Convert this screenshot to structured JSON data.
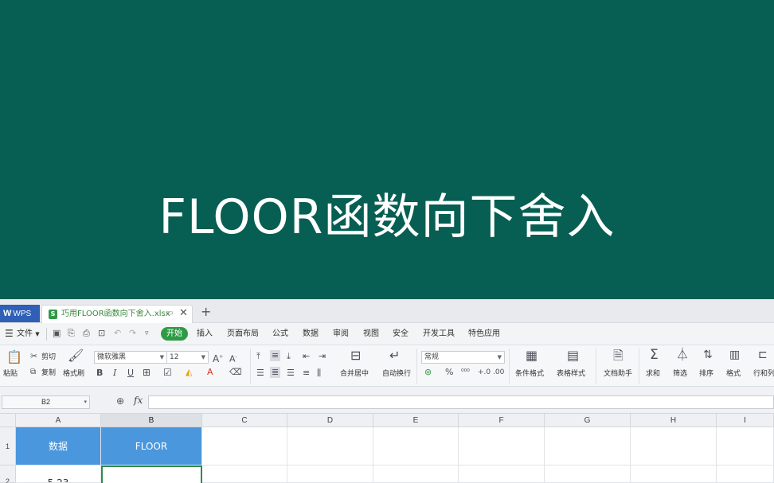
{
  "banner": {
    "title": "FLOOR函数向下舍入",
    "bg_color": "#075e52"
  },
  "tabs": {
    "wps_label": "WPS",
    "doc_name": "巧用FLOOR函数向下舍入.xlsx",
    "doc_icon": "S",
    "add": "+"
  },
  "menu": {
    "file": "文件",
    "items": [
      "开始",
      "插入",
      "页面布局",
      "公式",
      "数据",
      "审阅",
      "视图",
      "安全",
      "开发工具",
      "特色应用"
    ],
    "active_color": "#2e9b44"
  },
  "ribbon": {
    "paste": "粘贴",
    "cut": "剪切",
    "copy": "复制",
    "format_painter": "格式刷",
    "font_name": "微软雅黑",
    "font_size": "12",
    "merge_center": "合并居中",
    "auto_wrap": "自动换行",
    "number_format": "常规",
    "conditional_format": "条件格式",
    "table_style": "表格样式",
    "doc_assistant": "文档助手",
    "sum": "求和",
    "filter": "筛选",
    "sort": "排序",
    "format": "格式",
    "row_col": "行和列"
  },
  "formula_bar": {
    "name_box": "B2",
    "fx": "fx",
    "value": ""
  },
  "sheet": {
    "columns": [
      "A",
      "B",
      "C",
      "D",
      "E",
      "F",
      "G",
      "H",
      "I"
    ],
    "rows": [
      "1",
      "2"
    ],
    "cells": {
      "A1": "数据",
      "B1": "FLOOR",
      "A2": "5.23",
      "B2": ""
    },
    "header_fill": "#4a97dd",
    "selection_color": "#2e8b47"
  }
}
